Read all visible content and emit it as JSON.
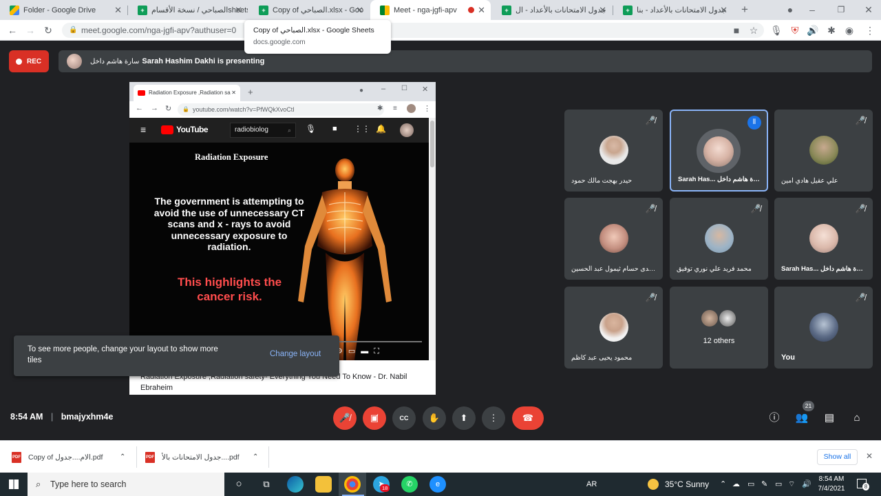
{
  "browser": {
    "tabs": [
      {
        "title": "Folder - Google Drive",
        "favicon": "drive-icon"
      },
      {
        "title": "الصباحي / نسخة الأقسامsheets",
        "favicon": "sheets-icon"
      },
      {
        "title": "Copy of الصباحي.xlsx - Goo",
        "favicon": "sheets-icon"
      },
      {
        "title": "Meet - nga-jgfi-apv",
        "favicon": "meet-icon"
      },
      {
        "title": "جدول الامتحانات بالأعداد - ال",
        "favicon": "sheets-icon"
      },
      {
        "title": "جدول الامتحانات بالأعداد - بنا",
        "favicon": "sheets-icon"
      }
    ],
    "url": "meet.google.com/nga-jgfi-apv?authuser=0",
    "tooltip": {
      "title": "Copy of الصباحي.xlsx - Google Sheets",
      "domain": "docs.google.com"
    }
  },
  "meet": {
    "rec_label": "REC",
    "presenting_name": "سارة هاشم داخل",
    "presenting_text": "Sarah Hashim Dakhi is presenting",
    "snackbar": {
      "message": "To see more people, change your layout to show more tiles",
      "action": "Change layout"
    },
    "tiles": [
      {
        "name": "حيدر بهجت مالك حمود",
        "muted": true
      },
      {
        "name": "Sarah Has... سارة هاشم داخل",
        "muted": false,
        "speaking": true
      },
      {
        "name": "علي عقيل هادي امين",
        "muted": true
      },
      {
        "name": "الهدى حسام ثيمول عبد الحسين ...",
        "muted": true
      },
      {
        "name": "محمد فريد علي نوري توفيق",
        "muted": true
      },
      {
        "name": "Sarah Has... سارة هاشم داخل",
        "muted": true
      },
      {
        "name": "محمود يحيى عبد كاظم",
        "muted": true
      },
      {
        "name": "12 others",
        "muted": false
      },
      {
        "name": "You",
        "muted": true
      }
    ],
    "time": "8:54 AM",
    "meeting_code": "bmajyxhm4e",
    "participants_count": "21"
  },
  "shared_screen": {
    "tab_title": "Radiation Exposure ,Radiation sa",
    "url": "youtube.com/watch?v=PfWQkXvoCtI",
    "yt_logo": "YouTube",
    "search_value": "radiobiolog",
    "video_title": "Radiation Exposure",
    "video_text": "The government is attempting to avoid the use of unnecessary CT scans and x - rays to avoid unnecessary exposure to radiation.",
    "video_highlight": "This highlights the cancer risk.",
    "caption": "Radiation Exposure ,Radiation safety- Everything You Need To Know - Dr. Nabil Ebraheim"
  },
  "downloads": {
    "items": [
      "Copy of الام....جدول.pdf",
      "جدول الامتحانات بالأ....pdf"
    ],
    "show_all": "Show all"
  },
  "taskbar": {
    "search_placeholder": "Type here to search",
    "language": "AR",
    "weather": "35°C  Sunny",
    "time": "8:54 AM",
    "date": "7/4/2021",
    "badge": "18",
    "notifications": "8"
  },
  "colors": {
    "meet_bg": "#202124",
    "tile_bg": "#3c4043",
    "red": "#ea4335",
    "link_blue": "#8ab4f8"
  }
}
